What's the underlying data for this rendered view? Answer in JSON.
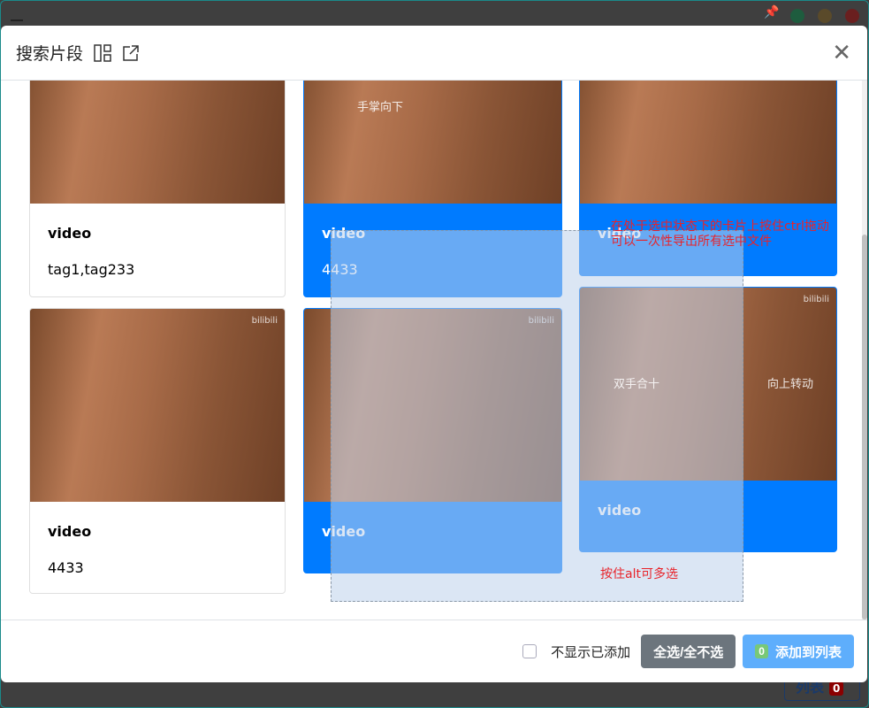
{
  "window": {
    "pin_icon": "pin-icon",
    "dots": [
      "#1e5c3e",
      "#5a4a2a",
      "#6a1f1f"
    ]
  },
  "background": {
    "list_label": "列表",
    "list_count": "0"
  },
  "dialog": {
    "title": "搜索片段",
    "close": "✕"
  },
  "cards": [
    {
      "title": "video",
      "tag": "tag1,tag233",
      "selected": false,
      "caption": ""
    },
    {
      "title": "video",
      "tag": "4433",
      "selected": true,
      "caption": "手掌向下"
    },
    {
      "title": "video",
      "tag": "",
      "selected": true,
      "caption": ""
    },
    {
      "title": "video",
      "tag": "4433",
      "selected": false,
      "caption": ""
    },
    {
      "title": "video",
      "tag": "",
      "selected": true,
      "caption": ""
    },
    {
      "title": "video",
      "tag": "",
      "selected": true,
      "caption": "双手合十",
      "caption2": "向上转动"
    }
  ],
  "hints": {
    "ctrl": "在处于选中状态下的卡片上按住ctrl拖动",
    "ctrl2": "可以一次性导出所有选中文件",
    "alt": "按住alt可多选"
  },
  "footer": {
    "hide_added": "不显示已添加",
    "select_all": "全选/全不选",
    "count": "0",
    "add": "添加到列表"
  }
}
